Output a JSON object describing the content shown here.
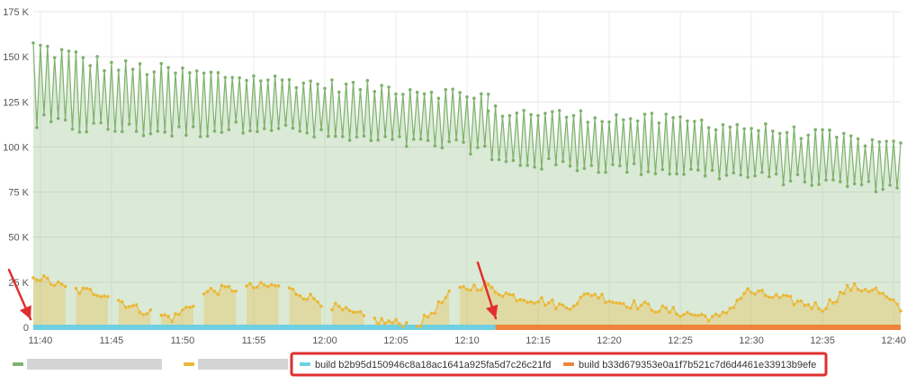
{
  "chart_data": {
    "type": "line",
    "y_ticks": [
      {
        "value": 0,
        "label": "0"
      },
      {
        "value": 25000,
        "label": "25 K"
      },
      {
        "value": 50000,
        "label": "50 K"
      },
      {
        "value": 75000,
        "label": "75 K"
      },
      {
        "value": 100000,
        "label": "100 K"
      },
      {
        "value": 125000,
        "label": "125 K"
      },
      {
        "value": 150000,
        "label": "150 K"
      },
      {
        "value": 175000,
        "label": "175 K"
      }
    ],
    "x_ticks": [
      "11:40",
      "11:45",
      "11:50",
      "11:55",
      "12:00",
      "12:05",
      "12:10",
      "12:15",
      "12:20",
      "12:25",
      "12:30",
      "12:35",
      "12:40"
    ],
    "ylim": [
      0,
      175000
    ],
    "grid": true,
    "legend_placement": "bottom-left",
    "series": [
      {
        "color": "#7eb26d",
        "fill": "area",
        "segments": [
          {
            "start": "11:39:30",
            "end": "12:11:30",
            "low": [
              113000,
              110000,
              108000,
              112000,
              105000,
              102000,
              99000
            ],
            "high": [
              156000,
              145000,
              141000,
              138000,
              134000,
              132000,
              128000
            ]
          },
          {
            "start": "12:11:30",
            "end": "12:40:30",
            "low": [
              92000,
              90000,
              88000,
              86000,
              83000,
              80000,
              77000
            ],
            "high": [
              120000,
              118000,
              116000,
              114000,
              110000,
              106000,
              100000
            ]
          }
        ]
      },
      {
        "color": "#eab839",
        "fill": "area",
        "segments": [
          {
            "start": "11:39:30",
            "end": "12:11:30",
            "trend": [
              29000,
              21000,
              19000,
              10000,
              5000,
              20000,
              22000,
              23000,
              16000,
              8000,
              3000,
              1000,
              20000,
              24000
            ]
          },
          {
            "start": "12:11:30",
            "end": "12:40:30",
            "trend": [
              22000,
              17000,
              15000,
              11000,
              19000,
              14000,
              12000,
              9000,
              7000,
              5000,
              20000,
              17000,
              14000,
              11000,
              22000,
              21000,
              10000
            ]
          }
        ]
      },
      {
        "name": "build b2b95d150946c8a18ac1641a925fa5d7c26c21fd",
        "color": "#6ed0e0",
        "start": "11:39:30",
        "end": "12:12:00",
        "value": 0
      },
      {
        "name": "build b33d679353e0a1f7b521c7d6d4461e33913b9efe",
        "color": "#ef843c",
        "start": "12:12:00",
        "end": "12:40:30",
        "value": 0
      }
    ]
  },
  "legend": {
    "items": [
      {
        "color": "#7eb26d",
        "label": ""
      },
      {
        "color": "#eab839",
        "label": ""
      },
      {
        "color": "#6ed0e0",
        "label": "build b2b95d150946c8a18ac1641a925fa5d7c26c21fd"
      },
      {
        "color": "#ef843c",
        "label": "build b33d679353e0a1f7b521c7d6d4461e33913b9efe"
      }
    ],
    "highlight_color": "#e02f2f"
  },
  "annotations": {
    "arrow_color": "#e02f2f"
  }
}
